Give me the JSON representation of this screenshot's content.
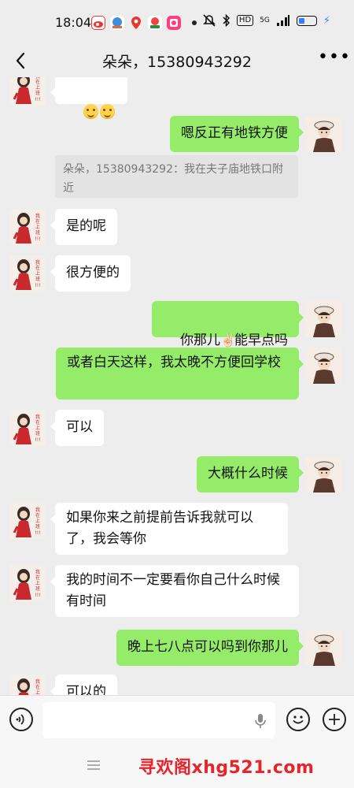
{
  "status_bar": {
    "time": "18:04",
    "app_icons": [
      "weibo-icon",
      "app-icon",
      "map-pin-icon",
      "app-icon-2",
      "app-icon-3"
    ],
    "network_label": "5G",
    "hd_label": "HD",
    "battery_level": 0.35
  },
  "header": {
    "title": "朵朵，15380943292"
  },
  "messages": [
    {
      "side": "other",
      "type": "emoji"
    },
    {
      "side": "me",
      "text": "嗯反正有地铁方便"
    },
    {
      "side": "quote",
      "text": "朵朵，15380943292：我在夫子庙地铁口附近"
    },
    {
      "side": "other",
      "text": "是的呢"
    },
    {
      "side": "other",
      "text": "很方便的"
    },
    {
      "side": "me",
      "text_before": "你那儿",
      "emoji": "✌🏻",
      "text_after": "能早点吗"
    },
    {
      "side": "me",
      "text": "或者白天这样，我太晚不方便回学校"
    },
    {
      "side": "other",
      "text": "可以"
    },
    {
      "side": "me",
      "text": "大概什么时候"
    },
    {
      "side": "other",
      "text": "如果你来之前提前告诉我就可以了，我会等你"
    },
    {
      "side": "other",
      "text": "我的时间不一定要看你自己什么时候有时间"
    },
    {
      "side": "me",
      "text": "晚上七八点可以吗到你那儿"
    },
    {
      "side": "other",
      "text": "可以的"
    }
  ],
  "avatar_text": "我在上班!!!",
  "watermark": "寻欢阁xhg521.com"
}
